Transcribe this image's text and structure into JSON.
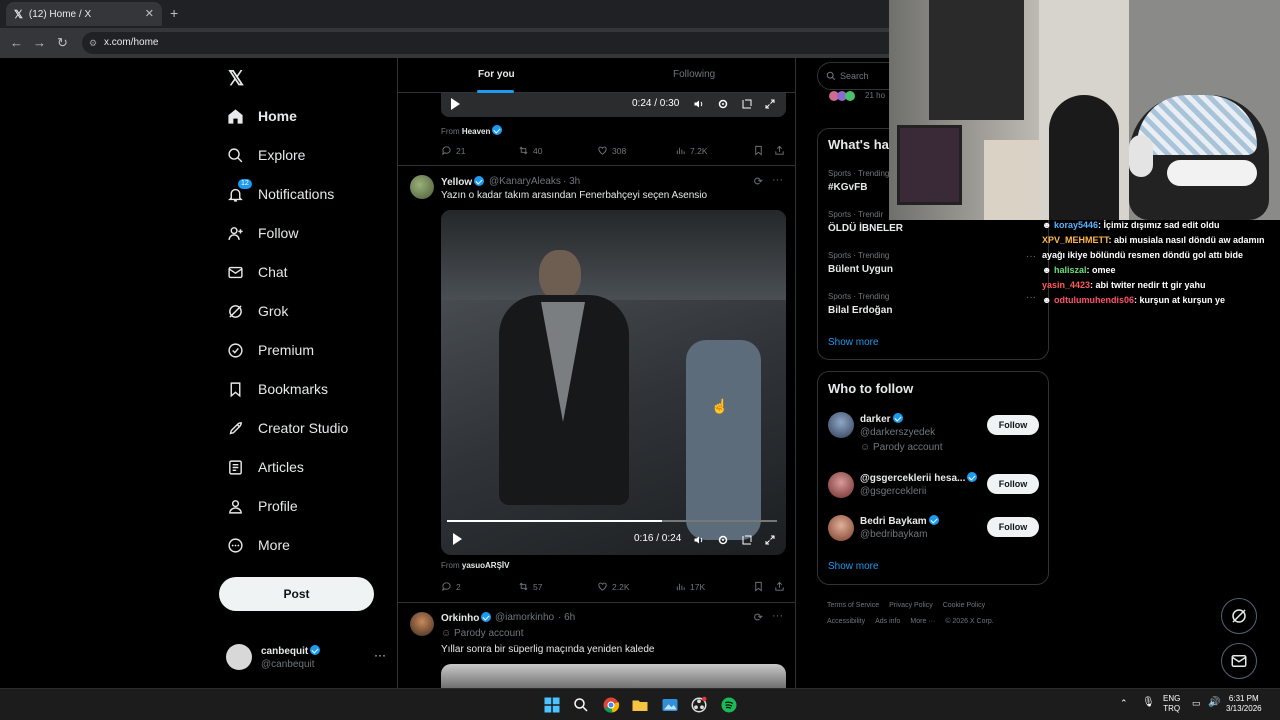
{
  "browser": {
    "tab_title": "(12) Home / X",
    "url": "x.com/home"
  },
  "nav": {
    "items": [
      {
        "label": "Home"
      },
      {
        "label": "Explore"
      },
      {
        "label": "Notifications",
        "badge": "12"
      },
      {
        "label": "Follow"
      },
      {
        "label": "Chat"
      },
      {
        "label": "Grok"
      },
      {
        "label": "Premium"
      },
      {
        "label": "Bookmarks"
      },
      {
        "label": "Creator Studio"
      },
      {
        "label": "Articles"
      },
      {
        "label": "Profile"
      },
      {
        "label": "More"
      }
    ],
    "post_label": "Post",
    "account": {
      "name": "canbequit",
      "handle": "@canbequit"
    }
  },
  "feed": {
    "tabs": {
      "for_you": "For you",
      "following": "Following"
    },
    "tweet0": {
      "video_time": "0:24 / 0:30",
      "from_label": "From",
      "from": "Heaven",
      "replies": "21",
      "reposts": "40",
      "likes": "308",
      "views": "7.2K"
    },
    "tweet1": {
      "name": "Yellow",
      "handle": "@KanaryAleaks",
      "time": "· 3h",
      "text": "Yazın o kadar takım arasından Fenerbahçeyi seçen Asensio",
      "video_time": "0:16 / 0:24",
      "video_progress": 0.65,
      "from_label": "From",
      "from": "yasuoARŞİV",
      "replies": "2",
      "reposts": "57",
      "likes": "2.2K",
      "views": "17K"
    },
    "tweet2": {
      "name": "Orkinho",
      "handle": "@iamorkinho",
      "time": "· 6h",
      "parody": "Parody account",
      "text": "Yıllar sonra bir süperlig maçında yeniden kalede"
    }
  },
  "right": {
    "search_placeholder": "Search",
    "top_time": "21 ho",
    "happening_title": "What's ha",
    "trends": [
      {
        "category": "Sports · Trending",
        "name": "#KGvFB"
      },
      {
        "category": "Sports · Trendir",
        "name": "ÖLDÜ İBNELER"
      },
      {
        "category": "Sports · Trending",
        "name": "Bülent Uygun"
      },
      {
        "category": "Sports · Trending",
        "name": "Bilal Erdoğan"
      }
    ],
    "show_more": "Show more",
    "who_title": "Who to follow",
    "who": [
      {
        "name": "darker",
        "handle": "@darkerszyedek",
        "extra": "Parody account",
        "button": "Follow"
      },
      {
        "name": "@gsgerceklerii hesa...",
        "handle": "@gsgerceklerii",
        "button": "Follow"
      },
      {
        "name": "Bedri Baykam",
        "handle": "@bedribaykam",
        "button": "Follow"
      }
    ],
    "who_show_more": "Show more",
    "footer": [
      "Terms of Service",
      "Privacy Policy",
      "Cookie Policy",
      "Accessibility",
      "Ads info",
      "More ···",
      "© 2026 X Corp."
    ]
  },
  "chat": [
    {
      "user": "koray5446",
      "color": "#5ab3ff",
      "msg": ": İçimiz dışımız sad edit oldu"
    },
    {
      "user": "XPV_MEHMETT",
      "color": "#ffb74d",
      "msg": ": abi musiala nasıl döndü aw adamın ayağı ikiye bölündü resmen döndü gol attı bide"
    },
    {
      "user": "haliszal",
      "color": "#66e07a",
      "msg": ": omee"
    },
    {
      "user": "yasin_4423",
      "color": "#ff5a5a",
      "msg": ": abi twiter nedir tt gir yahu"
    },
    {
      "user": "odtulumuhendis06",
      "color": "#ff4f6d",
      "msg": ": kurşun at kurşun ye"
    }
  ],
  "taskbar": {
    "lang_top": "ENG",
    "lang_bottom": "TRQ",
    "time": "6:31 PM",
    "date": "3/13/2026"
  }
}
